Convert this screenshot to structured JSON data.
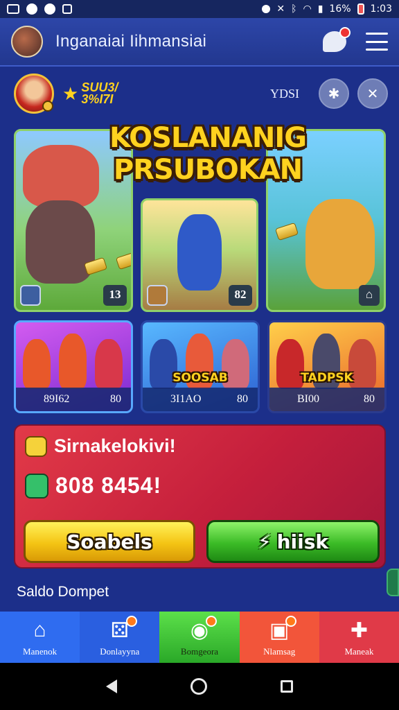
{
  "status_bar": {
    "battery": "16%",
    "time": "1:03"
  },
  "header": {
    "title": "Inganaiai Iihmansiai",
    "chat_badge": ""
  },
  "profile": {
    "name": "SUU3/ 3%I7I",
    "label": "YDSI"
  },
  "banner": {
    "title": "KOSLANANIG PRSUBOKAN",
    "panels": [
      {
        "count": "13"
      },
      {
        "count": "82"
      },
      {
        "count": ""
      }
    ]
  },
  "cards": [
    {
      "tag": "",
      "value": "89I62",
      "count": "80"
    },
    {
      "tag": "SOOSAB",
      "value": "3I1AO",
      "count": "80"
    },
    {
      "tag": "TADPSK",
      "value": "BI00",
      "count": "80"
    }
  ],
  "reward": {
    "title": "Sirnakelokivi!",
    "amount": "808 8454!",
    "btn_left": "Soabels",
    "btn_right": "hiisk"
  },
  "wallet_label": "Saldo Dompet",
  "bottom_nav": [
    {
      "label": "Manenok",
      "icon": "home-icon"
    },
    {
      "label": "Donlayyna",
      "icon": "dice-icon"
    },
    {
      "label": "Bomgeora",
      "icon": "orb-icon"
    },
    {
      "label": "Nlamsag",
      "icon": "chat-icon"
    },
    {
      "label": "Maneak",
      "icon": "puzzle-icon"
    }
  ]
}
